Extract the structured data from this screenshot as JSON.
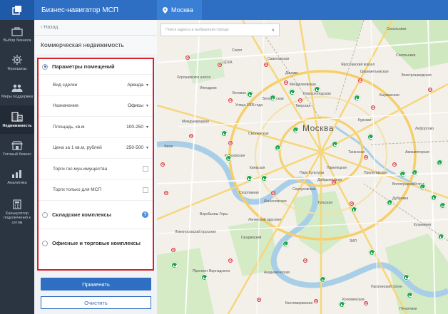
{
  "header": {
    "app_title": "Бизнес-навигатор МСП",
    "city": "Москва"
  },
  "rail": {
    "items": [
      {
        "label": "Выбор бизнеса",
        "icon": "briefcase-icon"
      },
      {
        "label": "Франшизы",
        "icon": "gear-icon"
      },
      {
        "label": "Меры поддержки",
        "icon": "people-icon"
      },
      {
        "label": "Недвижимость",
        "icon": "building-icon"
      },
      {
        "label": "Готовый бизнес",
        "icon": "store-icon"
      },
      {
        "label": "Аналитика",
        "icon": "chart-icon"
      },
      {
        "label": "Калькулятор подключения к сетям",
        "icon": "calculator-icon"
      }
    ]
  },
  "panel": {
    "back_label": "Назад",
    "title": "Коммерческая недвижимость",
    "section_params": "Параметры помещений",
    "deal_type_label": "Вид сделки",
    "deal_type_value": "Аренда",
    "purpose_label": "Назначение",
    "purpose_value": "Офисы",
    "area_label": "Площадь, кв.м",
    "area_value": "100-250",
    "price_label": "Цена за 1 кв.м, рублей",
    "price_value": "250-500",
    "auction_state_label": "Торги гос.мун.имущества",
    "auction_smb_label": "Торги только для МСП",
    "section_warehouse": "Складские комплексы",
    "section_office": "Офисные и торговые комплексы",
    "help": "?",
    "apply": "Применить",
    "clear": "Очистить"
  },
  "map": {
    "search_placeholder": "Поиск адреса в выбранном городе",
    "city_label": "Москва",
    "labels": {
      "sokolniki": "Сокольники",
      "yaroslav": "Ярославский вокзал",
      "central_station": "ЦСКА",
      "hippodrome": "Ипподром",
      "tverskaya": "Тверская",
      "kurskaya": "Курская",
      "taganskaya": "Таганская",
      "paveletskaya": "Павелецкая",
      "park_kultury": "Парк Культуры",
      "serpukhovskaya": "Серпуховская",
      "tulskaya": "Тульская",
      "shabolovskaya": "Шаболовская",
      "sportivnaya": "Спортивная",
      "kievskaya": "Киевская",
      "kutuzovskaya": "Кутузовская",
      "fili": "Фили",
      "gagarinsky": "Гагаринский",
      "leninsky": "Ленинский проспект",
      "akademicheskaya": "Академическая",
      "nagatinsky": "Нагатинский Затон",
      "pechatniki": "Печатники",
      "kolomenskaya": "Коломенская",
      "vorobyovy": "Воробьевы Горы",
      "lomonosovsky": "Ломоносовский проспект",
      "zil": "ЗИЛ",
      "volgogradsky": "Волгоградский пр-т",
      "kuzminki": "Кузьминки",
      "aviamotornaya": "Авиамоторная",
      "baumanskaya": "Бауманская",
      "sokol": "Сокол",
      "mendeleevskaya": "Менделеевская",
      "mezhdunarodnaya": "Международная",
      "dobryninskaya": "Добрынинская",
      "proletarskaya": "Пролетарская",
      "dubrovka": "Дубровка",
      "kantemirovskaya": "Кантемировская",
      "lefortovo": "Лефортово",
      "smolenskaya": "Смоленская",
      "begovaya": "Беговая",
      "dinamo": "Динамо",
      "ulitsa_1905": "Улица 1905 года",
      "belorusskaya": "Белорусская",
      "novoslobodskaya": "Новослободская",
      "savelovskaya": "Савеловская",
      "khoroshevskoe": "Хорошевское шоссе",
      "sheremetyevskaya": "Шереметьевская",
      "elektrozavodskaya": "Электрозаводская",
      "pr_vernadskogo": "Проспект Вернадского"
    }
  },
  "colors": {
    "brand_blue": "#2e6fc3",
    "highlight_red": "#d61f26",
    "pin_green": "#1fa84a",
    "rail_bg": "#2b3542"
  }
}
